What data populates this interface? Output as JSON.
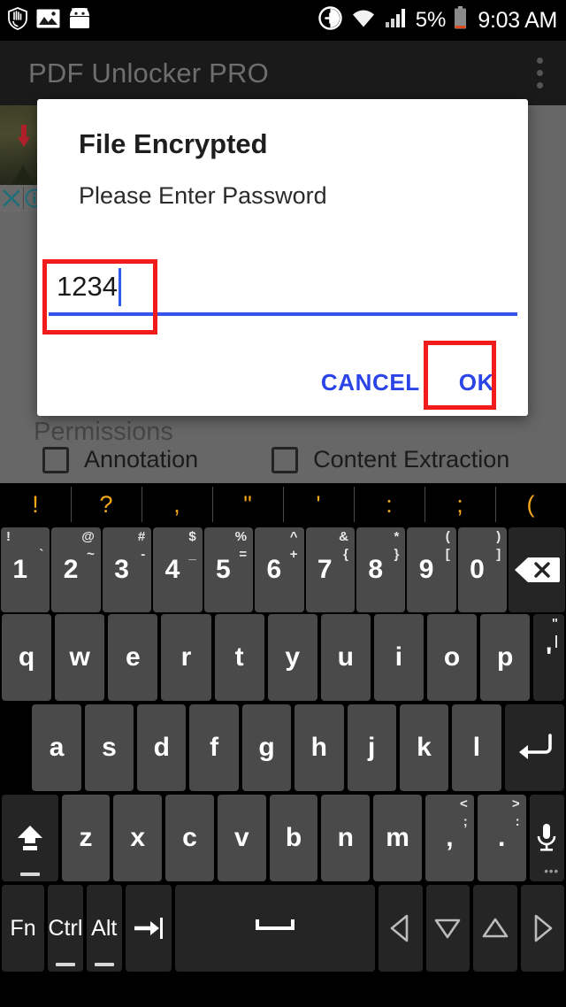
{
  "status_bar": {
    "left_icons": [
      "do-not-disturb-icon",
      "image-icon",
      "android-robot-icon"
    ],
    "right_icons": [
      "add-circle-icon",
      "wifi-icon",
      "signal-icon"
    ],
    "battery_percent": "5%",
    "time": "9:03 AM"
  },
  "app_bar": {
    "title": "PDF Unlocker PRO",
    "overflow_icon": "more-vert-icon"
  },
  "app_content": {
    "thumbnail": {
      "close_icon": "close-icon",
      "info_icon": "info-icon"
    },
    "permissions_title": "Permissions",
    "permissions": [
      {
        "label": "Annotation",
        "checked": false
      },
      {
        "label": "Content Extraction",
        "checked": false
      }
    ]
  },
  "dialog": {
    "title": "File Encrypted",
    "message": "Please Enter Password",
    "password_value": "1234",
    "password_placeholder": "",
    "cancel_label": "CANCEL",
    "ok_label": "OK",
    "accent_color": "#2b44e8",
    "underline_color": "#3355ee",
    "annotation_color": "#f11b1b"
  },
  "keyboard": {
    "suggestions": [
      "!",
      "?",
      ",",
      "\"",
      "'",
      ":",
      ";",
      "("
    ],
    "row_numbers": [
      {
        "main": "1",
        "tl": "!",
        "tr": "`"
      },
      {
        "main": "2",
        "tl": "@",
        "tr": "~"
      },
      {
        "main": "3",
        "tl": "#",
        "tr": "-"
      },
      {
        "main": "4",
        "tl": "$",
        "tr": "_"
      },
      {
        "main": "5",
        "tl": "%",
        "tr": "="
      },
      {
        "main": "6",
        "tl": "^",
        "tr": "+"
      },
      {
        "main": "7",
        "tl": "&",
        "tr": "{"
      },
      {
        "main": "8",
        "tl": "*",
        "tr": "}"
      },
      {
        "main": "9",
        "tl": "(",
        "tr": "["
      },
      {
        "main": "0",
        "tl": ")",
        "tr": "]"
      }
    ],
    "backspace_icon": "backspace-icon",
    "row_q": [
      "q",
      "w",
      "e",
      "r",
      "t",
      "y",
      "u",
      "i",
      "o",
      "p"
    ],
    "apostrophe": {
      "main": "'",
      "tl": "\"",
      "tr": "|"
    },
    "row_a": [
      "a",
      "s",
      "d",
      "f",
      "g",
      "h",
      "j",
      "k",
      "l"
    ],
    "enter_icon": "enter-icon",
    "shift_icon": "shift-icon",
    "row_z": [
      "z",
      "x",
      "c",
      "v",
      "b",
      "n",
      "m"
    ],
    "comma": {
      "main": ",",
      "tl": "<",
      "tr": ";"
    },
    "period": {
      "main": ".",
      "tl": ">",
      "tr": ":"
    },
    "mic_icon": "microphone-icon",
    "bottom_row": [
      "Fn",
      "Ctrl",
      "Alt"
    ],
    "tab_icon": "tab-icon",
    "space_label": "",
    "arrows": [
      "arrow-left-icon",
      "arrow-down-icon",
      "arrow-up-icon",
      "arrow-right-icon"
    ]
  }
}
